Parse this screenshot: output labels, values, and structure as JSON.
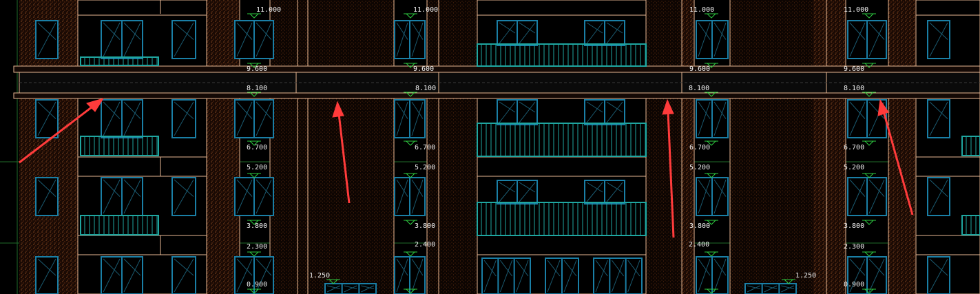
{
  "drawing": {
    "elevation_labels": [
      "11.000",
      "9.600",
      "8.100",
      "6.700",
      "5.200",
      "3.800",
      "2.300",
      "2.400",
      "1.250",
      "0.900"
    ],
    "columns": [
      {
        "id": "col-a",
        "labels": [
          "11.000",
          "9.600",
          "8.100",
          "6.700",
          "5.200",
          "3.800",
          "2.300",
          "0.900"
        ]
      },
      {
        "id": "col-b",
        "labels": [
          "11.000",
          "9.600",
          "8.100",
          "6.700",
          "5.200",
          "3.800",
          "2.400"
        ]
      },
      {
        "id": "col-c",
        "labels": [
          "11.000",
          "9.600",
          "8.100",
          "6.700",
          "5.200",
          "3.800",
          "2.400"
        ]
      },
      {
        "id": "col-d",
        "labels": [
          "11.000",
          "9.600",
          "8.100",
          "6.700",
          "5.200",
          "3.800",
          "2.300",
          "0.900"
        ]
      }
    ],
    "extra_labels": [
      "1.250",
      "1.250"
    ]
  },
  "colors": {
    "background": "#000000",
    "outline": "#e8b893",
    "window": "#1a7fa6",
    "railing": "#1fa6a0",
    "brick": "#7a3a18",
    "marker": "#2ecc40",
    "arrow": "#ff3b3b",
    "text": "#f2f2f2"
  },
  "icons": [
    "elevation-marker-icon",
    "red-arrow-icon"
  ]
}
